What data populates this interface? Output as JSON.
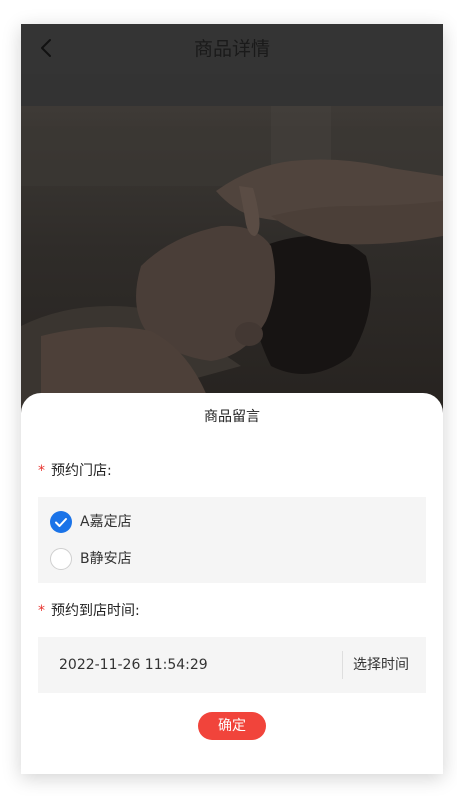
{
  "navbar": {
    "title": "商品详情",
    "back_icon": "chevron-left-icon"
  },
  "sheet": {
    "title": "商品留言",
    "store_label": "预约门店:",
    "required_mark": "*",
    "stores": [
      {
        "label": "A嘉定店",
        "checked": true
      },
      {
        "label": "B静安店",
        "checked": false
      }
    ],
    "time_label": "预约到店时间:",
    "time_value": "2022-11-26 11:54:29",
    "time_pick_label": "选择时间",
    "confirm_label": "确定"
  },
  "colors": {
    "accent_blue": "#1a73e8",
    "required_red": "#e8322d",
    "confirm_red": "#f1443b",
    "overlay": "#343434"
  }
}
